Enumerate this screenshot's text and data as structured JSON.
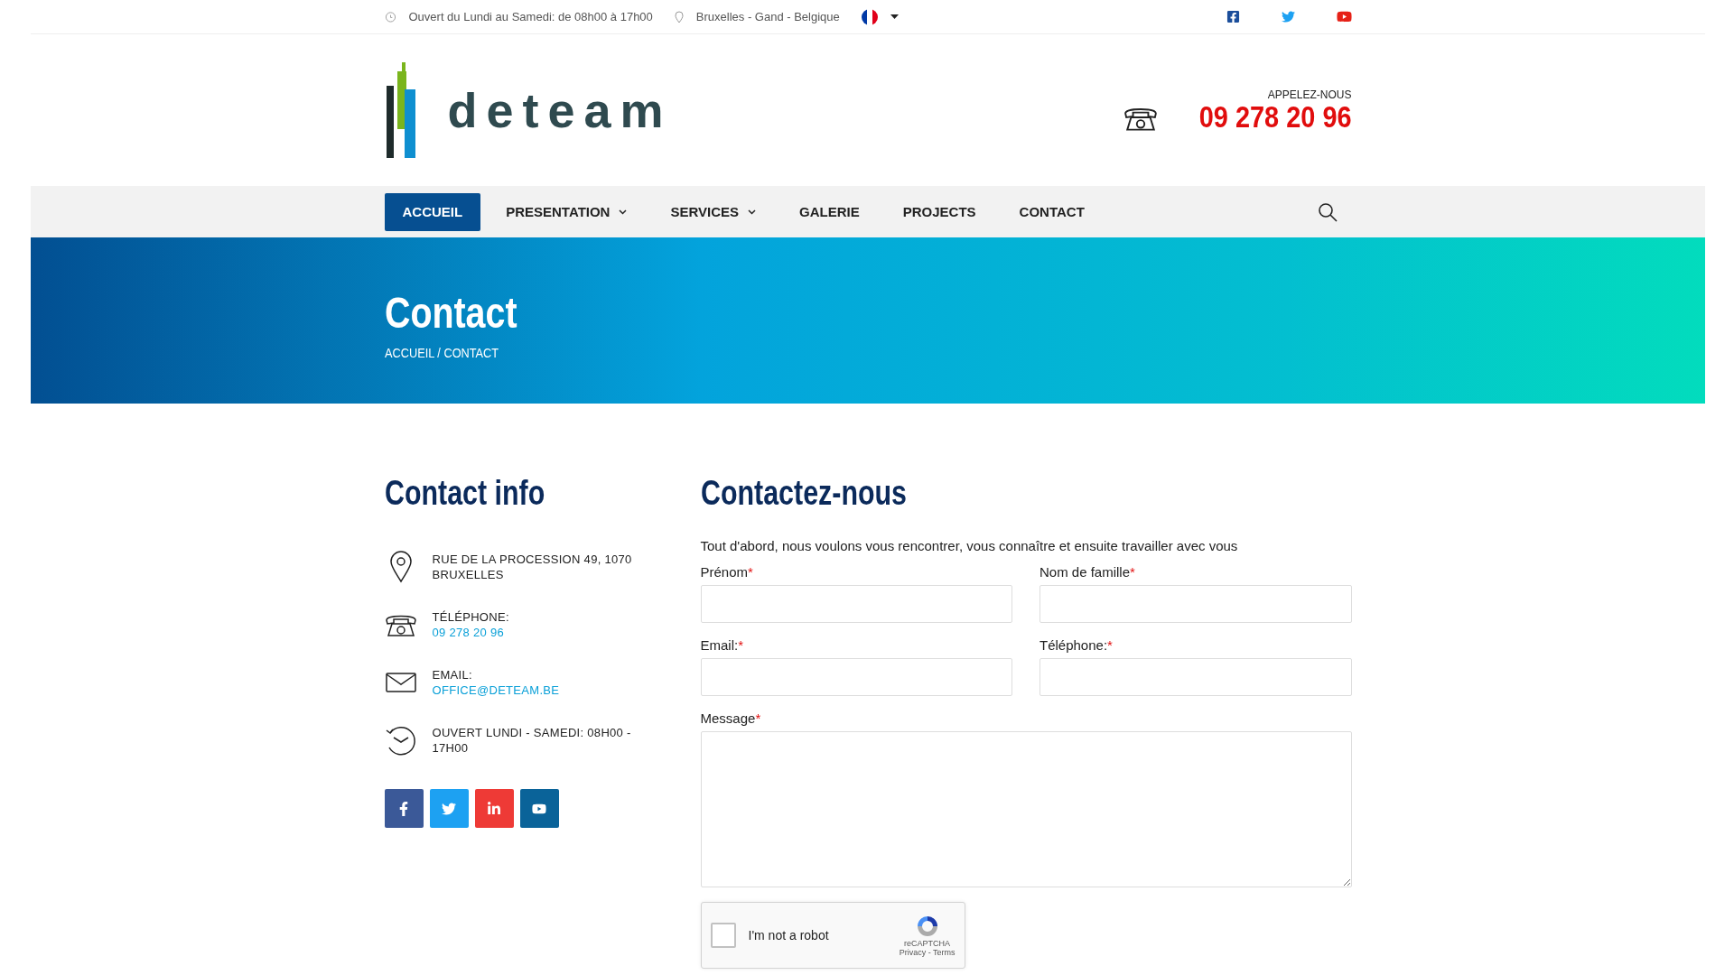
{
  "top_bar": {
    "hours": "Ouvert du Lundi au Samedi: de 08h00 à 17h00",
    "location": "Bruxelles - Gand - Belgique"
  },
  "header": {
    "logo_text": "deteam",
    "call_label": "APPELEZ-NOUS",
    "phone": "09 278 20 96"
  },
  "nav": [
    {
      "label": "ACCUEIL",
      "selected": true,
      "dropdown": false
    },
    {
      "label": "PRESENTATION",
      "selected": false,
      "dropdown": true
    },
    {
      "label": "SERVICES",
      "selected": false,
      "dropdown": true
    },
    {
      "label": "GALERIE",
      "selected": false,
      "dropdown": false
    },
    {
      "label": "PROJECTS",
      "selected": false,
      "dropdown": false
    },
    {
      "label": "CONTACT",
      "selected": false,
      "dropdown": false
    }
  ],
  "banner": {
    "title": "Contact",
    "breadcrumb": "ACCUEIL / CONTACT"
  },
  "contact_info": {
    "title": "Contact info",
    "items": [
      {
        "kind": "address",
        "label": "RUE DE LA PROCESSION 49, 1070 BRUXELLES"
      },
      {
        "kind": "phone",
        "label": "TÉLÉPHONE:",
        "link": "09 278 20 96"
      },
      {
        "kind": "email",
        "label": "EMAIL:",
        "link": "OFFICE@DETEAM.BE"
      },
      {
        "kind": "hours",
        "label": "OUVERT LUNDI - SAMEDI: 08H00 - 17H00"
      }
    ],
    "social": [
      {
        "kind": "facebook",
        "color": "#3b5998"
      },
      {
        "kind": "twitter",
        "color": "#1da1f2"
      },
      {
        "kind": "linkedin",
        "color": "#ee3a36"
      },
      {
        "kind": "youtube",
        "color": "#0a6399"
      }
    ]
  },
  "form": {
    "title": "Contactez-nous",
    "intro": "Tout d'abord, nous voulons vous rencontrer, vous connaître et ensuite travailler avec vous",
    "fields": [
      {
        "label": "Prénom",
        "required_mark": "*",
        "kind": "input"
      },
      {
        "label": "Nom de famille",
        "required_mark": "*",
        "kind": "input"
      },
      {
        "label": "Email:",
        "required_mark": "*",
        "kind": "input"
      },
      {
        "label": "Téléphone:",
        "required_mark": "*",
        "kind": "input"
      },
      {
        "label": "Message",
        "required_mark": "*",
        "kind": "textarea"
      }
    ],
    "captcha": {
      "label": "I'm not a robot",
      "checked": false,
      "brand": "reCAPTCHA",
      "links": "Privacy - Terms"
    }
  }
}
